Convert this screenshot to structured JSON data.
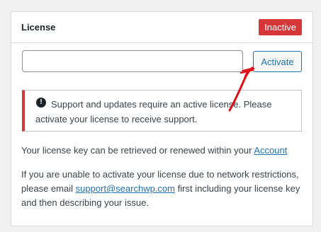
{
  "card": {
    "title": "License",
    "status_badge": "Inactive",
    "license_input": {
      "value": "",
      "placeholder": ""
    },
    "activate_button": "Activate",
    "notice": {
      "icon": "exclamation-circle-icon",
      "text": "Support and updates require an active license. Please activate your license to receive support."
    },
    "info": {
      "text_before": "Your license key can be retrieved or renewed within your",
      "account_link": "Account"
    },
    "help": {
      "text_before": "If you are unable to activate your license due to network restrictions, please email",
      "email_link": "support@searchwp.com",
      "text_after": "first including your license key and then describing your issue."
    }
  },
  "annotation": {
    "icon": "red-hand-drawn-arrow",
    "color": "#e0101a"
  },
  "colors": {
    "accent": "#2271b1",
    "danger": "#d63638",
    "background": "#f0f0f1"
  }
}
